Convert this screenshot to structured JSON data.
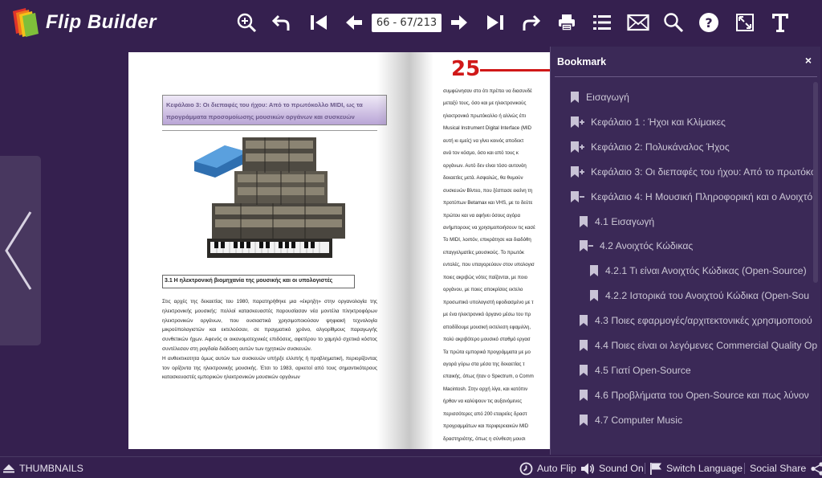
{
  "app": {
    "brand": "Flip Builder"
  },
  "toolbar": {
    "page_indicator": "66 - 67/213",
    "icons": [
      "zoom-in-icon",
      "undo-icon",
      "first-page-icon",
      "prev-page-icon",
      "next-page-icon",
      "last-page-icon",
      "redo-icon",
      "print-icon",
      "table-of-contents-icon",
      "email-icon",
      "search-icon",
      "help-icon",
      "fullscreen-icon",
      "text-icon"
    ]
  },
  "book": {
    "left_page": {
      "chapter_heading": "Κεφάλαιο 3: Οι διεπαφές του ήχου: Από το πρωτόκολλο MIDI, ως τα προγράμματα προσομοίωσης μουσικών οργάνων και συσκευών",
      "section_heading": "3.1 Η ηλεκτρονική βιομηχανία της μουσικής και οι υπολογιστές",
      "paragraphs": [
        "Στις αρχές της δεκαετίας του 1980, παρατηρήθηκε μια «έκρηξη» στην οργανολογία της ηλεκτρονικής μουσικής: πολλοί κατασκευαστές παρουσίασαν νέα μοντέλα πληκτροφόρων ηλεκτρονικών οργάνων, που ουσιαστικά χρησιμοποιούσαν ψηφιακή τεχνολογία μικροϋπολογιστών και εκτελούσαν, σε πραγματικό χρόνο, αλγορίθμους παραγωγής συνθετικών ήχων. Αφενός οι οικονομοτεχνικές επιδόσεις, αφετέρου το χαμηλό σχετικά κόστος συντέλεσαν στη ραγδαία διάδοση αυτών των ηχητικών συσκευών.",
        "Η ανθεκτικοτητα όμως αυτών των συσκευών υπήρξε ελλιπής ή προβληματική, περιορίζοντας τον ορίζοντα της ηλεκτρονικής μουσικής. Έτσι το 1983, αρκετοί από τους σημαντικότερους κατασκευαστές εμπορικών ηλεκτρονικών μουσικών οργάνων"
      ]
    },
    "right_page": {
      "page_number": "25",
      "lines": [
        "συμφώνησαν στο ότι πρέπει να διασυνδέ",
        "μεταξύ τους, όσο και με ηλεκτρονικούς",
        "ηλεκτρονικό πρωτόκολλο ή αλλιώς έπι",
        "Musical Instrument Digital Interface (MID",
        "αυτή κι εμείς) να γίνει κοινός αποδεκτ",
        "ανά τον κόσμο, όσο και από τους κ",
        "οργάνων. Αυτό δεν είναι τόσο αυτονόη",
        "δεκαετίες μετά. Ασφαλώς, θα θυμούν",
        "συσκευών Βίντεο, που ξέσπασε εκείνη τη",
        "προτύπων Betamax και VHS, με το δεύτε",
        "πρώτου και να αφήνει όσους αγόρα",
        "ανήμπορους να χρησιμοποιήσουν τις κασέ",
        "Το MIDI, λοιπόν, επικράτησε και διαδόθη",
        "επαγγελματίες μουσικούς. Το πρωτόκ",
        "εντολές, που υπαγορεύουν στον υπολογισ",
        "ποιες ακριβώς νότες παίζονται, με ποιο",
        "οργάνου, με ποιες αποκρίσεις εκτελο",
        "προσωπικό υπολογιστή εφοδιασμένο με τ",
        "με ένα ηλεκτρονικό όργανο μέσω του πρ",
        "αποδίδουμε μουσική εκτελεση εφαμιλλη,",
        "πολύ ακριβότερο μουσικό σταθμό εργασ",
        "Τα πρώτα εμπορικά προγράμματα με μο",
        "αγορά γύρω στα μέσα της δεκαετίας τ",
        "επαικής, όπως ήταν ο Spectrum, ο Comm",
        "Macintosh. Στην αρχή λίγα, και κατόπιν",
        "ήρθαν να καλύψουν τις αυξανόμενες",
        "περισσότερες από 200 εταιρείες δραστ",
        "προγραμμάτων και περιφερειακών MID",
        "δραστηριότης, όπως η σύνθεση μουσι"
      ]
    }
  },
  "bookmarks": {
    "title": "Bookmark",
    "close_label": "×",
    "items": [
      {
        "label": "Εισαγωγή",
        "level": 0,
        "state": "leaf"
      },
      {
        "label": "Κεφάλαιο 1 : Ήχοι και Κλίμακες",
        "level": 0,
        "state": "collapsed"
      },
      {
        "label": "Κεφάλαιο 2: Πολυκάναλος Ήχος",
        "level": 0,
        "state": "collapsed"
      },
      {
        "label": "Κεφάλαιο 3: Οι διεπαφές του ήχου: Από το πρωτόκο",
        "level": 0,
        "state": "collapsed"
      },
      {
        "label": "Κεφάλαιο 4: Η Μουσική Πληροφορική και ο Ανοιχτό",
        "level": 0,
        "state": "expanded"
      },
      {
        "label": "4.1 Εισαγωγή",
        "level": 1,
        "state": "leaf"
      },
      {
        "label": "4.2 Ανοιχτός Κώδικας",
        "level": 1,
        "state": "expanded"
      },
      {
        "label": "4.2.1 Τι είναι Ανοιχτός Κώδικας (Open-Source)",
        "level": 2,
        "state": "leaf"
      },
      {
        "label": "4.2.2 Ιστορικά του Ανοιχτού Κώδικα (Open-Sou",
        "level": 2,
        "state": "leaf"
      },
      {
        "label": "4.3 Ποιες εφαρμογές/αρχιτεκτονικές χρησιμοποιού",
        "level": 1,
        "state": "leaf"
      },
      {
        "label": "4.4 Ποιες είναι οι λεγόμενες Commercial Quality Op",
        "level": 1,
        "state": "leaf"
      },
      {
        "label": "4.5 Γιατί Open-Source",
        "level": 1,
        "state": "leaf"
      },
      {
        "label": "4.6 Προβλήματα του Open-Source και πως λύνον",
        "level": 1,
        "state": "leaf"
      },
      {
        "label": "4.7 Computer Music",
        "level": 1,
        "state": "leaf"
      }
    ]
  },
  "bottombar": {
    "thumbnails": "THUMBNAILS",
    "auto_flip": "Auto Flip",
    "sound": "Sound On",
    "language": "Switch Language",
    "social": "Social Share"
  }
}
